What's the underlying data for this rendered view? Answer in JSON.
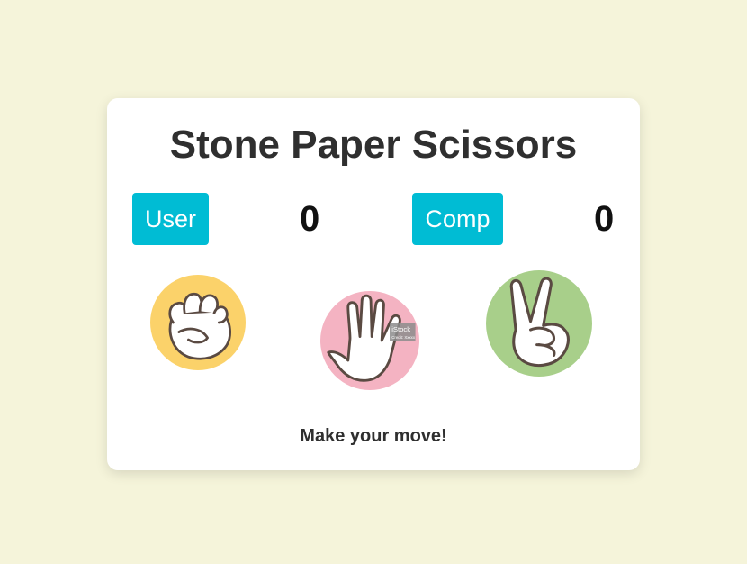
{
  "title": "Stone Paper Scissors",
  "scoreboard": {
    "user_label": "User",
    "user_score": "0",
    "comp_label": "Comp",
    "comp_score": "0"
  },
  "choices": [
    {
      "id": "stone",
      "icon": "fist-hand-icon",
      "color": "#fbd26a"
    },
    {
      "id": "paper",
      "icon": "open-hand-icon",
      "color": "#f4b3c2"
    },
    {
      "id": "scissors",
      "icon": "peace-hand-icon",
      "color": "#a8cf8a"
    }
  ],
  "message": "Make your move!",
  "colors": {
    "background": "#f5f4da",
    "accent": "#00bcd4"
  }
}
